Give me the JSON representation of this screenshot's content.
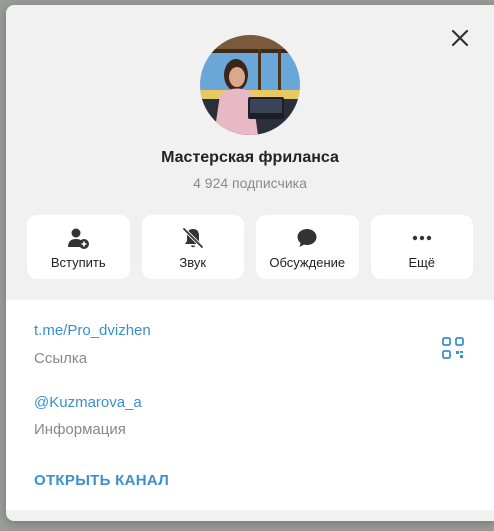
{
  "window": {
    "close_icon": "close-icon"
  },
  "channel": {
    "name": "Мастерская фриланса",
    "subscribers": "4 924 подписчика"
  },
  "actions": [
    {
      "label": "Вступить",
      "icon": "add-user-icon"
    },
    {
      "label": "Звук",
      "icon": "bell-muted-icon"
    },
    {
      "label": "Обсуждение",
      "icon": "chat-bubble-icon"
    },
    {
      "label": "Ещё",
      "icon": "more-dots-icon"
    }
  ],
  "info": {
    "link": "t.me/Pro_dvizhen",
    "link_label": "Ссылка",
    "handle": "@Kuzmarova_a",
    "handle_label": "Информация",
    "open_channel": "ОТКРЫТЬ КАНАЛ"
  },
  "colors": {
    "accent": "#3a8fd0",
    "panel_bg": "#f1f1f1",
    "card_bg": "#ffffff"
  }
}
